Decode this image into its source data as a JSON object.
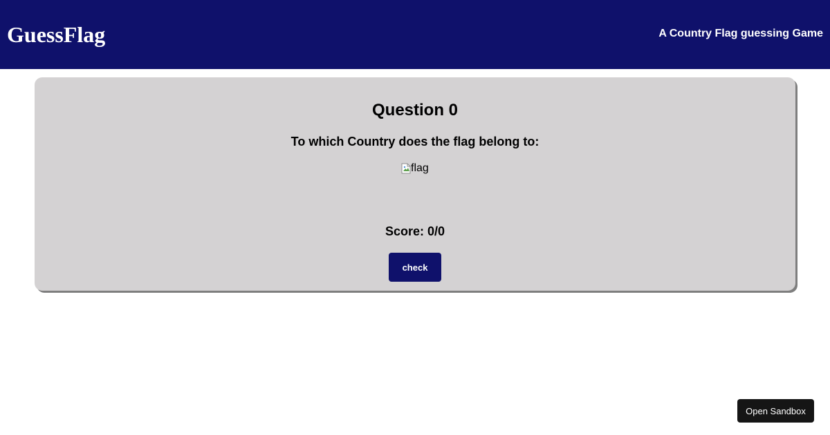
{
  "header": {
    "logo": "GuessFlag",
    "tagline": "A Country Flag guessing Game"
  },
  "quiz": {
    "question_title": "Question 0",
    "question_text": "To which Country does the flag belong to:",
    "flag_alt": "flag",
    "score": "Score: 0/0",
    "check_label": "check"
  },
  "sandbox": {
    "label": "Open Sandbox"
  },
  "colors": {
    "header_bg": "#0f116b",
    "card_bg": "#d4d2d3",
    "button_bg": "#0f116b",
    "sandbox_bg": "#151515"
  }
}
